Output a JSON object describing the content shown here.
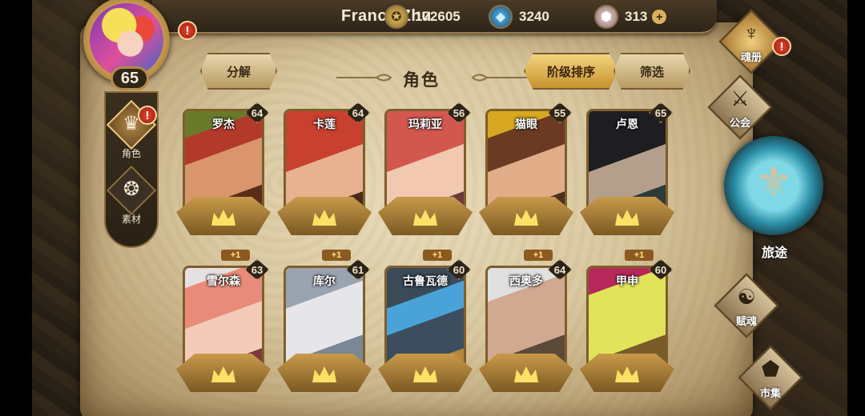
{
  "player": {
    "name": "FrancisZhu",
    "level": "65",
    "alert": "!"
  },
  "currencies": [
    {
      "name": "gold",
      "icon": "gold-coin-icon",
      "value": "172605"
    },
    {
      "name": "crystal",
      "icon": "blue-crystal-icon",
      "value": "3240"
    },
    {
      "name": "gem",
      "icon": "pink-gem-icon",
      "value": "313",
      "plus": "+"
    }
  ],
  "side_tabs": [
    {
      "label": "角色",
      "icon": "helmet-icon",
      "active": true,
      "alert": "!"
    },
    {
      "label": "素材",
      "icon": "material-icon",
      "active": false
    }
  ],
  "header": {
    "decompose": "分解",
    "title": "角色",
    "sort_by_rank": "阶级排序",
    "filter": "筛选"
  },
  "heroes": [
    {
      "name": "罗杰",
      "level": "64",
      "plus": ""
    },
    {
      "name": "卡莲",
      "level": "64",
      "plus": ""
    },
    {
      "name": "玛莉亚",
      "level": "56",
      "plus": ""
    },
    {
      "name": "猫眼",
      "level": "55",
      "plus": ""
    },
    {
      "name": "卢恩",
      "level": "65",
      "plus": ""
    },
    {
      "name": "雪尔森",
      "level": "63",
      "plus": "+1"
    },
    {
      "name": "库尔",
      "level": "61",
      "plus": "+1"
    },
    {
      "name": "古鲁瓦德",
      "level": "60",
      "plus": "+1"
    },
    {
      "name": "西奥多",
      "level": "64",
      "plus": "+1"
    },
    {
      "name": "甲申",
      "level": "60",
      "plus": "+1"
    }
  ],
  "right_nav": {
    "soul_book": "魂册",
    "guild": "公会",
    "journey": "旅途",
    "soul_grant": "赋魂",
    "market": "市集",
    "alert": "!"
  },
  "colors": {
    "parchment": "#d9c8a0",
    "gold_accent": "#c79a4e",
    "alert_red": "#e6452f"
  }
}
